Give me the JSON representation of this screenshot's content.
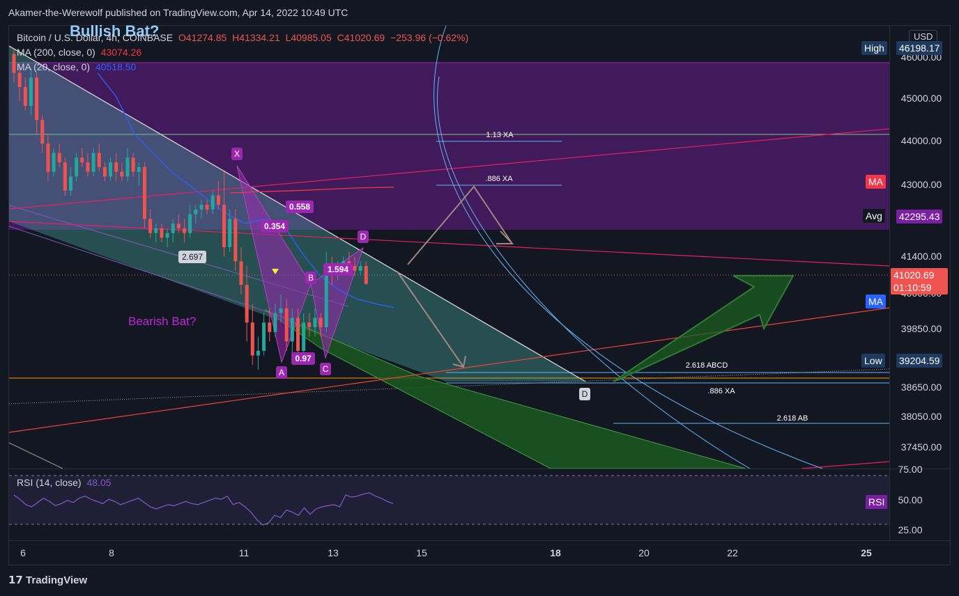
{
  "header": {
    "published": "Akamer-the-Werewolf published on TradingView.com, Apr 14, 2022 10:49 UTC"
  },
  "legend": {
    "symbol": "Bitcoin / U.S. Dollar, 4h, COINBASE",
    "o": "O41274.85",
    "h": "H41334.21",
    "l": "L40985.05",
    "c": "C41020.69",
    "chg": "−253.96 (−0.62%)",
    "ma200": "MA (200, close, 0)",
    "ma200_val": "43074.26",
    "ma20": "MA (20, close, 0)",
    "ma20_val": "40518.50",
    "rsi": "RSI (14, close)",
    "rsi_val": "48.05"
  },
  "annotations": {
    "bullish": "Bullish Bat?",
    "bearish": "Bearish Bat?",
    "points": {
      "X": "X",
      "A": "A",
      "B": "B",
      "C": "C",
      "D": "D",
      "D2": "D"
    },
    "ratios": {
      "r0558": "0.558",
      "r0354": "0.354",
      "r2697": "2.697",
      "r1594": "1.594",
      "r097": "0.97"
    },
    "fib": {
      "xa113": "1.13 XA",
      "xa886_top": ".886 XA",
      "abcd2618": "2.618 ABCD",
      "xa886_low": ".886 XA",
      "ab2618": "2.618 AB"
    }
  },
  "price_axis": {
    "currency": "USD",
    "ticks": [
      "46000.00",
      "45000.00",
      "44000.00",
      "43000.00",
      "41400.00",
      "40000.00",
      "39850.00",
      "38650.00",
      "38050.00",
      "37450.00"
    ],
    "badges": {
      "high_label": "High",
      "high_val": "46198.17",
      "ma_label": "MA",
      "avg_label": "Avg",
      "avg_val": "42295.43",
      "last": "41020.69",
      "countdown": "01:10:59",
      "ma2_label": "MA",
      "low_label": "Low",
      "low_val": "39204.59"
    },
    "rsi_ticks": [
      "75.00",
      "50.00",
      "25.00"
    ],
    "rsi_label": "RSI"
  },
  "time_axis": [
    "6",
    "8",
    "11",
    "13",
    "15",
    "18",
    "20",
    "22",
    "25"
  ],
  "footer": {
    "brand": "TradingView"
  },
  "colors": {
    "bg": "#131722",
    "up": "#26a69a",
    "down": "#ef5350",
    "purple": "#7b1fa2",
    "ma200": "#f23645",
    "ma20": "#2962ff",
    "rsi": "#7e57c2"
  },
  "chart_data": {
    "type": "candlestick",
    "title": "Bitcoin / U.S. Dollar, 4h, COINBASE",
    "ylim": [
      37100,
      46500
    ],
    "yticks": [
      46000,
      45000,
      44000,
      43000,
      41400,
      40000,
      39850,
      38650,
      38050,
      37450
    ],
    "xticks": [
      "6",
      "8",
      "11",
      "13",
      "15",
      "18",
      "20",
      "22",
      "25"
    ],
    "candles": [
      [
        45900,
        46000,
        45300,
        45500
      ],
      [
        45500,
        45700,
        44900,
        45200
      ],
      [
        45200,
        45400,
        44700,
        44800
      ],
      [
        44800,
        45600,
        44600,
        45400
      ],
      [
        45400,
        45500,
        44200,
        44500
      ],
      [
        44500,
        44600,
        43800,
        44000
      ],
      [
        44000,
        44200,
        43200,
        43400
      ],
      [
        43400,
        43900,
        43300,
        43800
      ],
      [
        43800,
        44000,
        43500,
        43600
      ],
      [
        43600,
        43700,
        42900,
        43000
      ],
      [
        43000,
        43500,
        42900,
        43300
      ],
      [
        43300,
        43800,
        43200,
        43700
      ],
      [
        43700,
        43900,
        43500,
        43600
      ],
      [
        43600,
        43800,
        43300,
        43400
      ],
      [
        43400,
        43900,
        43300,
        43800
      ],
      [
        43800,
        44000,
        43400,
        43500
      ],
      [
        43500,
        43600,
        43200,
        43300
      ],
      [
        43300,
        43700,
        43200,
        43600
      ],
      [
        43600,
        43800,
        43200,
        43400
      ],
      [
        43400,
        43600,
        43200,
        43300
      ],
      [
        43300,
        43900,
        43200,
        43700
      ],
      [
        43700,
        43800,
        43300,
        43400
      ],
      [
        43400,
        43600,
        43100,
        43500
      ],
      [
        43500,
        43600,
        42200,
        42400
      ],
      [
        42400,
        42600,
        42000,
        42100
      ],
      [
        42100,
        42300,
        41900,
        42200
      ],
      [
        42200,
        42300,
        41900,
        42000
      ],
      [
        42000,
        42200,
        41800,
        42100
      ],
      [
        42100,
        42400,
        41900,
        42300
      ],
      [
        42300,
        42500,
        42100,
        42200
      ],
      [
        42200,
        42400,
        41900,
        42100
      ],
      [
        42100,
        42700,
        42000,
        42500
      ],
      [
        42500,
        42700,
        42300,
        42600
      ],
      [
        42600,
        42800,
        42400,
        42700
      ],
      [
        42700,
        42800,
        42500,
        42600
      ],
      [
        42600,
        43000,
        42500,
        42900
      ],
      [
        42900,
        43200,
        42600,
        42700
      ],
      [
        42700,
        43400,
        41600,
        41800
      ],
      [
        41800,
        42600,
        41700,
        42400
      ],
      [
        42400,
        42600,
        41300,
        41500
      ],
      [
        41500,
        41800,
        40800,
        41000
      ],
      [
        41000,
        41400,
        39800,
        40200
      ],
      [
        40200,
        40600,
        39300,
        39500
      ],
      [
        39500,
        39900,
        39200,
        39600
      ],
      [
        39600,
        40400,
        39500,
        40200
      ],
      [
        40200,
        40500,
        39800,
        40000
      ],
      [
        40000,
        40600,
        39900,
        40400
      ],
      [
        40400,
        40800,
        40200,
        40500
      ],
      [
        40500,
        40700,
        39600,
        39800
      ],
      [
        39800,
        40500,
        39400,
        40300
      ],
      [
        40300,
        40500,
        39400,
        39600
      ],
      [
        39600,
        40400,
        39500,
        40200
      ],
      [
        40200,
        40400,
        39900,
        40100
      ],
      [
        40100,
        40500,
        39900,
        40300
      ],
      [
        40300,
        40400,
        39900,
        40100
      ],
      [
        40100,
        41700,
        40000,
        41400
      ],
      [
        41400,
        41600,
        41000,
        41200
      ],
      [
        41200,
        41500,
        41100,
        41300
      ],
      [
        41300,
        41600,
        41200,
        41500
      ],
      [
        41500,
        41700,
        41300,
        41400
      ],
      [
        41400,
        41600,
        41200,
        41300
      ],
      [
        41300,
        41500,
        41200,
        41400
      ],
      [
        41400,
        41500,
        41000,
        41020
      ]
    ],
    "ma200": [
      42950,
      42980,
      43000,
      43030,
      43060,
      43074
    ],
    "ma20": [
      45500,
      45000,
      44200,
      43800,
      43400,
      43100,
      42800,
      42500,
      42300,
      42400,
      42300,
      41700,
      41200,
      40900,
      40700,
      40600,
      40518
    ],
    "rsi": {
      "ylim": [
        15,
        80
      ],
      "values": [
        56,
        52,
        47,
        45,
        49,
        53,
        50,
        46,
        48,
        51,
        49,
        53,
        55,
        52,
        50,
        48,
        52,
        50,
        47,
        49,
        51,
        53,
        49,
        45,
        43,
        45,
        47,
        46,
        48,
        50,
        48,
        47,
        49,
        51,
        53,
        52,
        55,
        47,
        49,
        45,
        40,
        33,
        28,
        30,
        37,
        35,
        42,
        40,
        37,
        44,
        38,
        43,
        45,
        46,
        47,
        45,
        56,
        54,
        55,
        57,
        58,
        55,
        53,
        50,
        48
      ],
      "levels": [
        70,
        50,
        30
      ]
    }
  }
}
